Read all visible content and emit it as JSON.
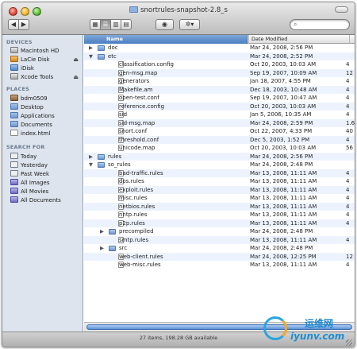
{
  "window": {
    "title": "snortrules-snapshot-2.8_s"
  },
  "toolbar": {
    "back": "◀",
    "forward": "▶",
    "views": [
      "▦",
      "☰",
      "▥",
      "▤"
    ],
    "eye": "◉",
    "action": "✲▾",
    "search": {
      "value": "",
      "placeholder": ""
    },
    "search_icon": "search-icon"
  },
  "sidebar": {
    "devices_header": "DEVICES",
    "devices": [
      {
        "label": "Macintosh HD",
        "icon": "hard-disk-icon"
      },
      {
        "label": "LaCie Disk",
        "icon": "external-disk-icon",
        "eject": "⏏"
      },
      {
        "label": "iDisk",
        "icon": "idisk-icon"
      },
      {
        "label": "Xcode Tools",
        "icon": "disk-image-icon",
        "eject": "⏏"
      }
    ],
    "places_header": "PLACES",
    "places": [
      {
        "label": "bdm0509",
        "icon": "home-icon"
      },
      {
        "label": "Desktop",
        "icon": "desktop-icon"
      },
      {
        "label": "Applications",
        "icon": "applications-icon"
      },
      {
        "label": "Documents",
        "icon": "documents-icon"
      },
      {
        "label": "index.html",
        "icon": "file-icon"
      }
    ],
    "search_header": "SEARCH FOR",
    "search_for": [
      {
        "label": "Today",
        "icon": "clock-icon"
      },
      {
        "label": "Yesterday",
        "icon": "clock-icon"
      },
      {
        "label": "Past Week",
        "icon": "clock-icon"
      },
      {
        "label": "All Images",
        "icon": "smart-folder-icon"
      },
      {
        "label": "All Movies",
        "icon": "smart-folder-icon"
      },
      {
        "label": "All Documents",
        "icon": "smart-folder-icon"
      }
    ]
  },
  "columns": {
    "name": "Name",
    "date": "Date Modified"
  },
  "rows": [
    {
      "name": "doc",
      "date": "Mar 24, 2008, 2:56 PM",
      "size": "",
      "kind": "folder",
      "level": 0,
      "disc": "▶"
    },
    {
      "name": "etc",
      "date": "Mar 24, 2008, 2:52 PM",
      "size": "",
      "kind": "folder",
      "level": 0,
      "disc": "▼"
    },
    {
      "name": "classification.config",
      "date": "Oct 20, 2003, 10:03 AM",
      "size": "4",
      "kind": "file",
      "level": 1,
      "disc": ""
    },
    {
      "name": "gen-msg.map",
      "date": "Sep 19, 2007, 10:09 AM",
      "size": "12",
      "kind": "file",
      "level": 1,
      "disc": ""
    },
    {
      "name": "generators",
      "date": "Jan 18, 2007, 4:55 PM",
      "size": "4",
      "kind": "file",
      "level": 1,
      "disc": ""
    },
    {
      "name": "Makefile.am",
      "date": "Dec 18, 2003, 10:48 AM",
      "size": "4",
      "kind": "file",
      "level": 1,
      "disc": ""
    },
    {
      "name": "open-test.conf",
      "date": "Sep 19, 2007, 10:47 AM",
      "size": "4",
      "kind": "file",
      "level": 1,
      "disc": ""
    },
    {
      "name": "reference.config",
      "date": "Oct 20, 2003, 10:03 AM",
      "size": "4",
      "kind": "file",
      "level": 1,
      "disc": ""
    },
    {
      "name": "sid",
      "date": "Jan 5, 2006, 10:35 AM",
      "size": "4",
      "kind": "file",
      "level": 1,
      "disc": ""
    },
    {
      "name": "sid-msg.map",
      "date": "Mar 24, 2008, 2:59 PM",
      "size": "1.6",
      "kind": "file",
      "level": 1,
      "disc": ""
    },
    {
      "name": "snort.conf",
      "date": "Oct 22, 2007, 4:33 PM",
      "size": "40",
      "kind": "file",
      "level": 1,
      "disc": ""
    },
    {
      "name": "threshold.conf",
      "date": "Dec 5, 2003, 1:52 PM",
      "size": "4",
      "kind": "file",
      "level": 1,
      "disc": ""
    },
    {
      "name": "unicode.map",
      "date": "Oct 20, 2003, 10:03 AM",
      "size": "56",
      "kind": "file",
      "level": 1,
      "disc": ""
    },
    {
      "name": "rules",
      "date": "Mar 24, 2008, 2:56 PM",
      "size": "",
      "kind": "folder",
      "level": 0,
      "disc": "▶"
    },
    {
      "name": "so_rules",
      "date": "Mar 24, 2008, 2:48 PM",
      "size": "",
      "kind": "folder",
      "level": 0,
      "disc": "▼"
    },
    {
      "name": "bad-traffic.rules",
      "date": "Mar 13, 2008, 11:11 AM",
      "size": "4",
      "kind": "file",
      "level": 1,
      "disc": ""
    },
    {
      "name": "dos.rules",
      "date": "Mar 13, 2008, 11:11 AM",
      "size": "4",
      "kind": "file",
      "level": 1,
      "disc": ""
    },
    {
      "name": "exploit.rules",
      "date": "Mar 13, 2008, 11:11 AM",
      "size": "4",
      "kind": "file",
      "level": 1,
      "disc": ""
    },
    {
      "name": "misc.rules",
      "date": "Mar 13, 2008, 11:11 AM",
      "size": "4",
      "kind": "file",
      "level": 1,
      "disc": ""
    },
    {
      "name": "netbios.rules",
      "date": "Mar 13, 2008, 11:11 AM",
      "size": "4",
      "kind": "file",
      "level": 1,
      "disc": ""
    },
    {
      "name": "nntp.rules",
      "date": "Mar 13, 2008, 11:11 AM",
      "size": "4",
      "kind": "file",
      "level": 1,
      "disc": ""
    },
    {
      "name": "p2p.rules",
      "date": "Mar 13, 2008, 11:11 AM",
      "size": "4",
      "kind": "file",
      "level": 1,
      "disc": ""
    },
    {
      "name": "precompiled",
      "date": "Mar 24, 2008, 2:48 PM",
      "size": "",
      "kind": "folder",
      "level": 1,
      "disc": "▶"
    },
    {
      "name": "smtp.rules",
      "date": "Mar 13, 2008, 11:11 AM",
      "size": "4",
      "kind": "file",
      "level": 1,
      "disc": ""
    },
    {
      "name": "src",
      "date": "Mar 24, 2008, 2:48 PM",
      "size": "",
      "kind": "folder",
      "level": 1,
      "disc": "▶"
    },
    {
      "name": "web-client.rules",
      "date": "Mar 24, 2008, 12:25 PM",
      "size": "12",
      "kind": "file",
      "level": 1,
      "disc": ""
    },
    {
      "name": "web-misc.rules",
      "date": "Mar 13, 2008, 11:11 AM",
      "size": "4",
      "kind": "file",
      "level": 1,
      "disc": ""
    }
  ],
  "status": "27 items, 198.28 GB available",
  "watermark": {
    "line1": "运维网",
    "line2": "iyunv.com"
  },
  "colors": {
    "selection": "#4c7fc0",
    "stripe": "#edf3fe",
    "sidebar": "#dde4ed"
  }
}
